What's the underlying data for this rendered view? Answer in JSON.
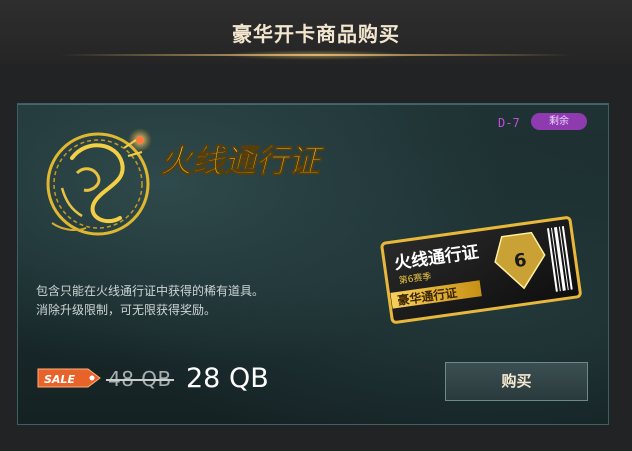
{
  "header": {
    "title": "豪华开卡商品购买"
  },
  "item": {
    "code": "D-7",
    "badge": "剩余",
    "name": "火线通行证",
    "description_line1": "包含只能在火线通行证中获得的稀有道具。",
    "description_line2": "消除升级限制，可无限获得奖励。",
    "ticket_title": "火线通行证",
    "ticket_subtitle": "第6赛季",
    "ticket_tier": "豪华通行证",
    "ticket_season_number": "6"
  },
  "price": {
    "sale_label": "SALE",
    "original": "48 QB",
    "current": "28 QB"
  },
  "actions": {
    "buy_label": "购买"
  },
  "colors": {
    "gold": "#e8c341",
    "accent_purple": "#8f3bb0",
    "sale_orange": "#e8632a"
  },
  "icons": {
    "emblem": "dragon-emblem-icon",
    "ticket": "ticket-icon"
  }
}
